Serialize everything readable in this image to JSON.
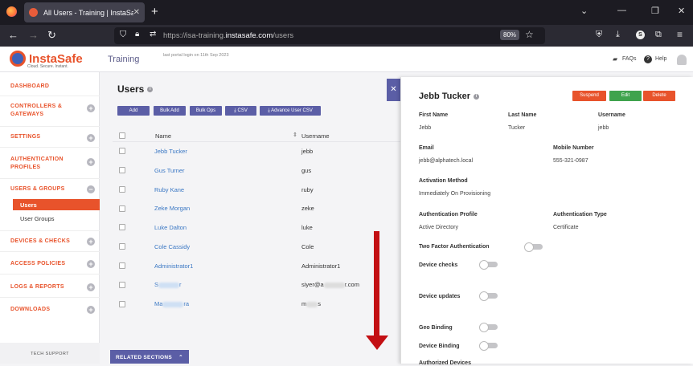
{
  "browser": {
    "tab_title": "All Users - Training | InstaSafe",
    "url_prefix": "https://isa-training.",
    "url_domain": "instasafe.com",
    "url_path": "/users",
    "zoom": "80%"
  },
  "header": {
    "brand": "InstaSafe",
    "tagline": "Cloud. Secure. Instant.",
    "section": "Training",
    "last_login": "last portal login on 11th Sep 2023",
    "faqs": "FAQs",
    "help": "Help"
  },
  "sidebar": {
    "items": [
      "DASHBOARD",
      "CONTROLLERS & GATEWAYS",
      "SETTINGS",
      "AUTHENTICATION PROFILES",
      "USERS & GROUPS",
      "DEVICES & CHECKS",
      "ACCESS POLICIES",
      "LOGS & REPORTS",
      "DOWNLOADS"
    ],
    "sub_users": "Users",
    "sub_groups": "User Groups",
    "tech_support": "TECH SUPPORT"
  },
  "main": {
    "title": "Users",
    "buttons": [
      "Add",
      "Bulk Add",
      "Bulk Ops",
      "CSV",
      "Advance User CSV"
    ],
    "col_name": "Name",
    "col_username": "Username",
    "related": "RELATED SECTIONS",
    "rows": [
      {
        "name": "Jebb Tucker",
        "username": "jebb"
      },
      {
        "name": "Gus Turner",
        "username": "gus"
      },
      {
        "name": "Ruby Kane",
        "username": "ruby"
      },
      {
        "name": "Zeke Morgan",
        "username": "zeke"
      },
      {
        "name": "Luke Dalton",
        "username": "luke"
      },
      {
        "name": "Cole Cassidy",
        "username": "Cole"
      },
      {
        "name": "Administrator1",
        "username": "Administrator1"
      },
      {
        "name": "S",
        "name_end": "r",
        "username": "siyer@a",
        "username_end": "r.com"
      },
      {
        "name": "Ma",
        "name_end": "ra",
        "username": "m",
        "username_end": "s"
      }
    ]
  },
  "panel": {
    "name": "Jebb Tucker",
    "btn_suspend": "Suspend",
    "btn_edit": "Edit",
    "btn_delete": "Delete",
    "first_name_label": "First Name",
    "first_name": "Jebb",
    "last_name_label": "Last Name",
    "last_name": "Tucker",
    "username_label": "Username",
    "username": "jebb",
    "email_label": "Email",
    "email": "jebb@alphatech.local",
    "mobile_label": "Mobile Number",
    "mobile": "555-321-0987",
    "activation_label": "Activation Method",
    "activation": "Immediately On Provisioning",
    "auth_profile_label": "Authentication Profile",
    "auth_profile": "Active Directory",
    "auth_type_label": "Authentication Type",
    "auth_type": "Certificate",
    "tfa_label": "Two Factor Authentication",
    "device_checks_label": "Device checks",
    "device_updates_label": "Device updates",
    "geo_label": "Geo Binding",
    "device_binding_label": "Device Binding",
    "authorized_label": "Authorized Devices"
  },
  "colors": {
    "accent": "#e8532b",
    "primary": "#5b5ea6",
    "suspend": "#e8532b",
    "edit": "#3fa34d",
    "delete": "#e8532b",
    "link": "#3b78c4"
  }
}
